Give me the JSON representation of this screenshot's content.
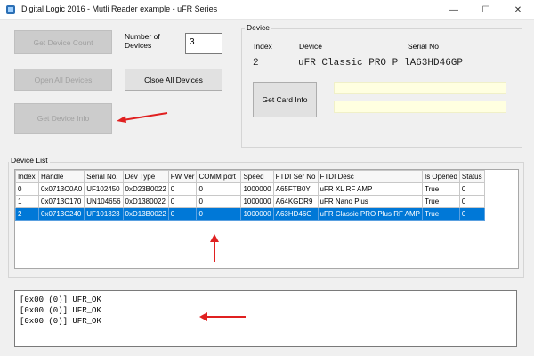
{
  "window": {
    "title": "Digital Logic 2016 - Mutli Reader example - uFR Series",
    "minimize_glyph": "—",
    "maximize_glyph": "☐",
    "close_glyph": "✕"
  },
  "controls": {
    "get_device_count_label": "Get Device Count",
    "number_of_devices_label": "Number of\nDevices",
    "number_of_devices_value": "3",
    "open_all_devices_label": "Open All Devices",
    "close_all_devices_label": "Clsoe All Devices",
    "get_device_info_label": "Get Device Info"
  },
  "device_group": {
    "caption": "Device",
    "index_header": "Index",
    "device_header": "Device",
    "serial_header": "Serial No",
    "index_value": "2",
    "device_value": "uFR Classic PRO P",
    "serial_value": "lA63HD46GP",
    "get_card_info_label": "Get Card Info",
    "card_field_1": "",
    "card_field_2": ""
  },
  "device_list": {
    "caption": "Device List",
    "columns": [
      "Index",
      "Handle",
      "Serial No.",
      "Dev Type",
      "FW Ver",
      "COMM port",
      "Speed",
      "FTDI Ser No",
      "FTDI Desc",
      "Is Opened",
      "Status"
    ],
    "rows": [
      [
        "0",
        "0x0713C0A0",
        "UF102450",
        "0xD23B0022",
        "0",
        "0",
        "1000000",
        "A65FTB0Y",
        "uFR XL RF AMP",
        "True",
        "0"
      ],
      [
        "1",
        "0x0713C170",
        "UN104656",
        "0xD1380022",
        "0",
        "0",
        "1000000",
        "A64KGDR9",
        "uFR Nano Plus",
        "True",
        "0"
      ],
      [
        "2",
        "0x0713C240",
        "UF101323",
        "0xD13B0022",
        "0",
        "0",
        "1000000",
        "A63HD46G",
        "uFR Classic PRO Plus RF AMP",
        "True",
        "0"
      ]
    ],
    "selected_row": 2
  },
  "log": {
    "lines": [
      "[0x00 (0)] UFR_OK",
      "[0x00 (0)] UFR_OK",
      "[0x00 (0)] UFR_OK"
    ]
  },
  "colors": {
    "annotation_arrow": "#e02020",
    "selection": "#0078d7",
    "card_field_bg": "#ffffe0"
  }
}
